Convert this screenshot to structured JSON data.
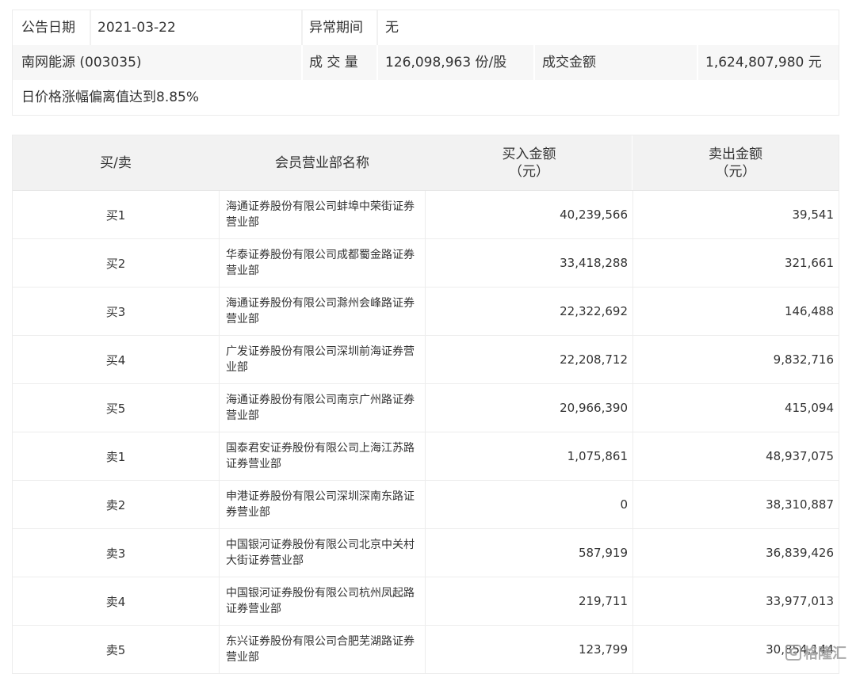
{
  "summary": {
    "announce_date_label": "公告日期",
    "announce_date_value": "2021-03-22",
    "abnormal_period_label": "异常期间",
    "abnormal_period_value": "无",
    "stock_name": "南网能源 (003035)",
    "volume_label": "成 交 量",
    "volume_value": "126,098,963 份/股",
    "amount_label": "成交金额",
    "amount_value": "1,624,807,980 元",
    "reason": "日价格涨幅偏离值达到8.85%"
  },
  "table": {
    "headers": {
      "side": "买/卖",
      "broker": "会员营业部名称",
      "buy_amount_line1": "买入金额",
      "buy_amount_line2": "（元）",
      "sell_amount_line1": "卖出金额",
      "sell_amount_line2": "（元）"
    },
    "rows": [
      {
        "side": "买1",
        "broker_line1": "海通证券股份有限公司蚌埠中荣街证券",
        "broker_line2": "营业部",
        "buy": "40,239,566",
        "sell": "39,541"
      },
      {
        "side": "买2",
        "broker_line1": "华泰证券股份有限公司成都蜀金路证券",
        "broker_line2": "营业部",
        "buy": "33,418,288",
        "sell": "321,661"
      },
      {
        "side": "买3",
        "broker_line1": "海通证券股份有限公司滁州会峰路证券",
        "broker_line2": "营业部",
        "buy": "22,322,692",
        "sell": "146,488"
      },
      {
        "side": "买4",
        "broker_line1": "广发证券股份有限公司深圳前海证券营",
        "broker_line2": "业部",
        "buy": "22,208,712",
        "sell": "9,832,716"
      },
      {
        "side": "买5",
        "broker_line1": "海通证券股份有限公司南京广州路证券",
        "broker_line2": "营业部",
        "buy": "20,966,390",
        "sell": "415,094"
      },
      {
        "side": "卖1",
        "broker_line1": "国泰君安证券股份有限公司上海江苏路",
        "broker_line2": "证券营业部",
        "buy": "1,075,861",
        "sell": "48,937,075"
      },
      {
        "side": "卖2",
        "broker_line1": "申港证券股份有限公司深圳深南东路证",
        "broker_line2": "券营业部",
        "buy": "0",
        "sell": "38,310,887"
      },
      {
        "side": "卖3",
        "broker_line1": "中国银河证券股份有限公司北京中关村",
        "broker_line2": "大街证券营业部",
        "buy": "587,919",
        "sell": "36,839,426"
      },
      {
        "side": "卖4",
        "broker_line1": "中国银河证券股份有限公司杭州凤起路",
        "broker_line2": "证券营业部",
        "buy": "219,711",
        "sell": "33,977,013"
      },
      {
        "side": "卖5",
        "broker_line1": "东兴证券股份有限公司合肥芜湖路证券",
        "broker_line2": "营业部",
        "buy": "123,799",
        "sell": "30,854,144"
      }
    ]
  },
  "watermark": {
    "logo_glyph": "G",
    "text": "格隆汇"
  }
}
